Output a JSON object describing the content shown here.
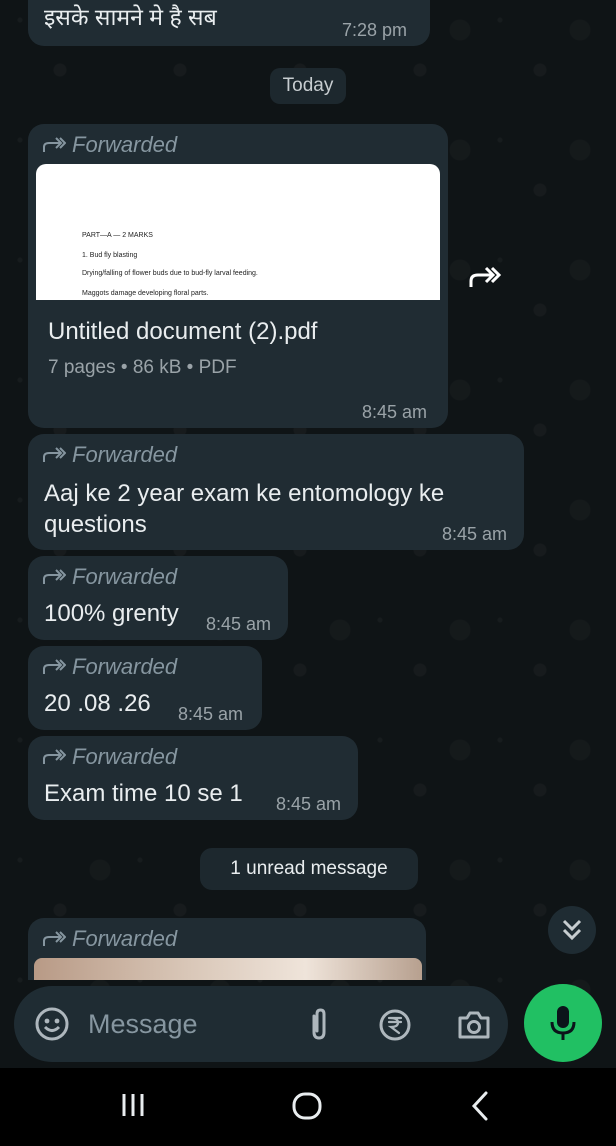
{
  "messages": {
    "top_partial": {
      "text": "इसके सामने मे है सब",
      "time": "7:28 pm"
    },
    "date_chip": "Today",
    "pdf": {
      "forwarded_label": "Forwarded",
      "preview_lines": [
        "PART—A — 2 MARKS",
        "1. Bud fly blasting",
        "Drying/falling of flower buds due to bud-fly larval feeding.",
        "Maggots damage developing floral parts."
      ],
      "file_name": "Untitled document (2).pdf",
      "meta": "7 pages • 86 kB • PDF",
      "time": "8:45 am"
    },
    "msg1": {
      "forwarded_label": "Forwarded",
      "text": "Aaj ke 2 year exam ke entomology ke questions",
      "time": "8:45 am"
    },
    "msg2": {
      "forwarded_label": "Forwarded",
      "text": "100% grenty",
      "time": "8:45 am"
    },
    "msg3": {
      "forwarded_label": "Forwarded",
      "text": "20 .08 .26",
      "time": "8:45 am"
    },
    "msg4": {
      "forwarded_label": "Forwarded",
      "text": "Exam time 10 se 1",
      "time": "8:45 am"
    },
    "unread_chip": "1 unread message",
    "last_forwarded_label": "Forwarded"
  },
  "composer": {
    "placeholder": "Message"
  },
  "icons": {
    "forwarded": "forward-arrow-icon",
    "share": "share-forward-icon",
    "scroll": "double-chevron-down-icon",
    "emoji": "emoji-sticker-icon",
    "attach": "paperclip-icon",
    "payment": "rupee-icon",
    "camera": "camera-icon",
    "mic": "microphone-icon",
    "nav_recents": "recents-icon",
    "nav_home": "home-icon",
    "nav_back": "back-icon"
  },
  "colors": {
    "bubble": "#202c33",
    "accent": "#21c063",
    "background": "#0f1416"
  }
}
